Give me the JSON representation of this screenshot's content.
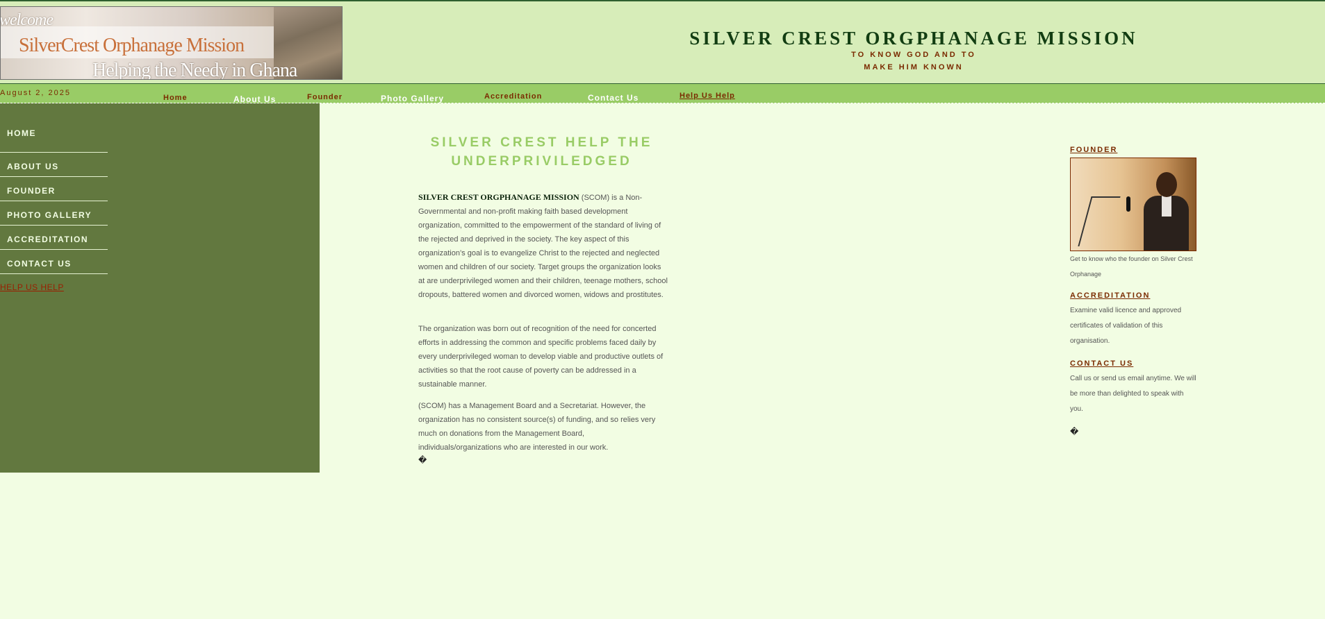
{
  "banner": {
    "welcome": "welcome",
    "mission": "SilverCrest Orphanage Mission",
    "helping": "Helping the Needy in Ghana"
  },
  "header": {
    "title": "SILVER CREST ORGPHANAGE MISSION",
    "tagline1": "TO KNOW GOD AND TO",
    "tagline2": "MAKE HIM KNOWN"
  },
  "navbar": {
    "date": "August 2, 2025",
    "items": [
      {
        "label": "Home"
      },
      {
        "label": "About Us"
      },
      {
        "label": "Founder"
      },
      {
        "label": "Photo Gallery"
      },
      {
        "label": "Accreditation"
      },
      {
        "label": "Contact Us"
      },
      {
        "label": "Help Us Help"
      }
    ]
  },
  "sidebar": {
    "items": [
      {
        "label": "HOME"
      },
      {
        "label": "ABOUT US"
      },
      {
        "label": "FOUNDER"
      },
      {
        "label": "PHOTO GALLERY"
      },
      {
        "label": "ACCREDITATION"
      },
      {
        "label": "CONTACT US"
      }
    ],
    "help_link": "HELP US HELP"
  },
  "main": {
    "heading": "SILVER CREST HELP THE UNDERPRIVILEDGED",
    "p1_lead": "SILVER CREST ORGPHANAGE MISSION",
    "p1_rest": " (SCOM) is a Non-Governmental and non-profit making faith based development organization, committed to the empowerment of the standard of living of the rejected and deprived in the society. The key aspect of this organization’s goal is to evangelize Christ to the rejected and neglected women and children of our society. Target groups the organization looks at are underprivileged women and their children, teenage mothers, school dropouts, battered women and divorced women, widows and prostitutes.",
    "p2": "The organization was born out of recognition of the need for concerted efforts in addressing the common and specific problems faced daily by every underprivileged woman to develop viable and productive outlets of activities so that the root cause of poverty can be addressed in a sustainable manner.",
    "p3": "(SCOM) has a Management Board and a Secretariat. However, the organization has no consistent source(s) of funding, and so relies very much on donations from the Management Board, individuals/organizations who are interested in our work.",
    "glyph": "�"
  },
  "right": {
    "founder_title": "FOUNDER",
    "founder_caption": "Get to know who the founder on Silver Crest Orphanage",
    "accreditation_title": "ACCREDITATION",
    "accreditation_text": "Examine valid licence and approved certificates of validation of this organisation.",
    "contact_title": "CONTACT US",
    "contact_text": "Call us or send us email anytime. We will be more than delighted to speak with you.",
    "glyph": "�"
  },
  "colors": {
    "header_bg": "#d7edb9",
    "nav_bg": "#99cc66",
    "sidebar_bg": "#62783f",
    "page_bg": "#f2fde3",
    "accent_brown": "#7a2a00",
    "heading_green": "#99cc66"
  }
}
